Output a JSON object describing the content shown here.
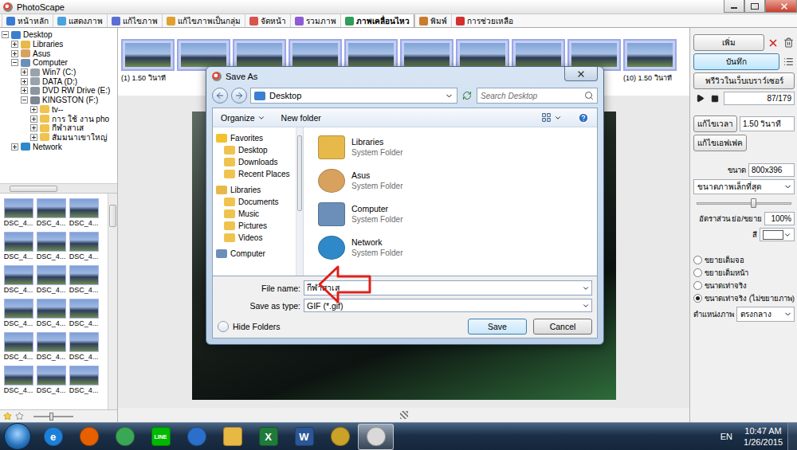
{
  "window": {
    "title": "PhotoScape"
  },
  "tabs": [
    {
      "label": "หน้าหลัก",
      "selected": false,
      "color": "#3a7bd5"
    },
    {
      "label": "แสดงภาพ",
      "selected": false,
      "color": "#4aa3df"
    },
    {
      "label": "แก้ไขภาพ",
      "selected": false,
      "color": "#5b6fd6"
    },
    {
      "label": "แก้ไขภาพเป็นกลุ่ม",
      "selected": false,
      "color": "#e0a030"
    },
    {
      "label": "จัดหน้า",
      "selected": false,
      "color": "#d9534f"
    },
    {
      "label": "รวมภาพ",
      "selected": false,
      "color": "#8e5bd6"
    },
    {
      "label": "ภาพเคลื่อนไหว",
      "selected": true,
      "color": "#2f9e5a"
    },
    {
      "label": "พิมพ์",
      "selected": false,
      "color": "#c97b2e"
    },
    {
      "label": "การช่วยเหลือ",
      "selected": false,
      "color": "#d62f2f"
    }
  ],
  "tree": [
    {
      "label": "Desktop",
      "kind": "desktop",
      "expanded": true,
      "children": [
        {
          "label": "Libraries",
          "kind": "library",
          "expanded": false,
          "children": []
        },
        {
          "label": "Asus",
          "kind": "user",
          "expanded": false,
          "children": []
        },
        {
          "label": "Computer",
          "kind": "computer",
          "expanded": true,
          "children": [
            {
              "label": "Win7 (C:)",
              "kind": "drive",
              "expanded": false,
              "children": []
            },
            {
              "label": "DATA (D:)",
              "kind": "drive",
              "expanded": false,
              "children": []
            },
            {
              "label": "DVD RW Drive (E:)",
              "kind": "dvd",
              "expanded": false,
              "children": []
            },
            {
              "label": "KINGSTON (F:)",
              "kind": "usb",
              "expanded": true,
              "children": [
                {
                  "label": "tv--",
                  "kind": "folder",
                  "expanded": false,
                  "children": []
                },
                {
                  "label": "การ ใช้ งาน pho",
                  "kind": "folder",
                  "expanded": false,
                  "children": []
                },
                {
                  "label": "กีฬาสาเส",
                  "kind": "folder",
                  "expanded": false,
                  "children": []
                },
                {
                  "label": "สัมมนาเขาใหญ่",
                  "kind": "folder",
                  "expanded": false,
                  "children": []
                }
              ]
            }
          ]
        },
        {
          "label": "Network",
          "kind": "network",
          "expanded": false,
          "children": []
        }
      ]
    }
  ],
  "thumbnails": [
    {
      "label": "DSC_4..."
    },
    {
      "label": "DSC_4..."
    },
    {
      "label": "DSC_4..."
    },
    {
      "label": "DSC_4..."
    },
    {
      "label": "DSC_4..."
    },
    {
      "label": "DSC_4..."
    },
    {
      "label": "DSC_4..."
    },
    {
      "label": "DSC_4..."
    },
    {
      "label": "DSC_4..."
    },
    {
      "label": "DSC_4..."
    },
    {
      "label": "DSC_4..."
    },
    {
      "label": "DSC_4..."
    },
    {
      "label": "DSC_4..."
    },
    {
      "label": "DSC_4..."
    },
    {
      "label": "DSC_4..."
    },
    {
      "label": "DSC_4..."
    },
    {
      "label": "DSC_4..."
    },
    {
      "label": "DSC_4..."
    }
  ],
  "filmstrip": [
    {
      "caption": "(1) 1.50 วินาที"
    },
    {
      "caption": ""
    },
    {
      "caption": ""
    },
    {
      "caption": ""
    },
    {
      "caption": ""
    },
    {
      "caption": ""
    },
    {
      "caption": ""
    },
    {
      "caption": ""
    },
    {
      "caption": ""
    },
    {
      "caption": "(10) 1.50 วินาที"
    }
  ],
  "controls": {
    "add": "เพิ่ม",
    "save": "บันทึก",
    "preview": "พรีวิวในเว็บเบราว์เซอร์",
    "counter": "87/179",
    "edit_time": "แก้ไขเวลา",
    "time_value": "1.50 วินาที",
    "edit_effect": "แก้ไขเอฟเฟค",
    "size_label": "ขนาด",
    "size_value": "800x396",
    "size_mode": "ขนาดภาพเล็กที่สุด",
    "scale": {
      "level": 0.6
    },
    "ratio_label": "อัตราส่วน ย่อ/ขยาย",
    "ratio_value": "100%",
    "color_label": "สี",
    "color_value": "#ffffff",
    "fit_options": [
      {
        "label": "ขยายเต็มจอ",
        "selected": false
      },
      {
        "label": "ขยายเต็มหน้า",
        "selected": false
      },
      {
        "label": "ขนาดเท่าจริง",
        "selected": false
      },
      {
        "label": "ขนาดเท่าจริง (ไม่ขยายภาพ)",
        "selected": true
      }
    ],
    "position_label": "ตำแหน่งภาพ",
    "position_value": "ตรงกลาง"
  },
  "dialog": {
    "title": "Save As",
    "address": "Desktop",
    "search_placeholder": "Search Desktop",
    "organize": "Organize",
    "new_folder": "New folder",
    "nav": [
      {
        "label": "Favorites",
        "kind": "favorites",
        "items": [
          "Desktop",
          "Downloads",
          "Recent Places"
        ]
      },
      {
        "label": "Libraries",
        "kind": "library",
        "items": [
          "Documents",
          "Music",
          "Pictures",
          "Videos"
        ]
      },
      {
        "label": "Computer",
        "kind": "computer",
        "items": []
      }
    ],
    "files": [
      {
        "name": "Libraries",
        "type": "System Folder",
        "kind": "library"
      },
      {
        "name": "Asus",
        "type": "System Folder",
        "kind": "user"
      },
      {
        "name": "Computer",
        "type": "System Folder",
        "kind": "computer"
      },
      {
        "name": "Network",
        "type": "System Folder",
        "kind": "network"
      }
    ],
    "file_name_label": "File name:",
    "file_name": "กีฬาสาเส",
    "type_label": "Save as type:",
    "type_value": "GIF (*.gif)",
    "hide_folders": "Hide Folders",
    "buttons": [
      {
        "label": "Save",
        "default": true
      },
      {
        "label": "Cancel",
        "default": false
      }
    ]
  },
  "taskbar": {
    "apps": [
      {
        "kind": "ie",
        "badge": "e",
        "selected": false
      },
      {
        "kind": "firefox",
        "badge": "",
        "selected": false
      },
      {
        "kind": "chrome",
        "badge": "",
        "selected": false
      },
      {
        "kind": "line",
        "badge": "LINE",
        "selected": false
      },
      {
        "kind": "earth",
        "badge": "",
        "selected": false
      },
      {
        "kind": "explorer",
        "badge": "",
        "selected": false
      },
      {
        "kind": "excel",
        "badge": "X",
        "selected": false
      },
      {
        "kind": "word",
        "badge": "W",
        "selected": false
      },
      {
        "kind": "disc",
        "badge": "",
        "selected": false
      },
      {
        "kind": "photoscape",
        "badge": "",
        "selected": true
      }
    ],
    "language": "EN",
    "time": "10:47 AM",
    "date": "1/26/2015"
  }
}
